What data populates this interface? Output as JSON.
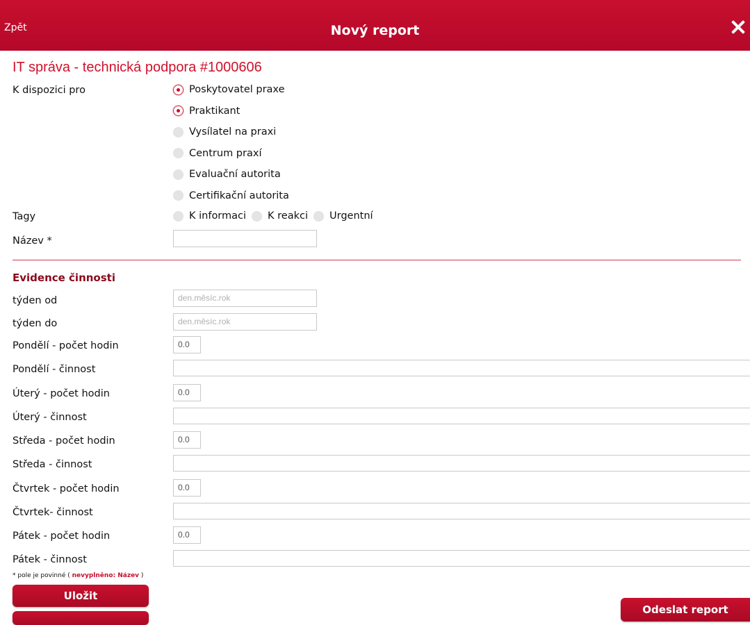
{
  "header": {
    "back_label": "Zpět",
    "title": "Nový report"
  },
  "heading": "IT správa - technická podpora #1000606",
  "availability": {
    "label": "K dispozici pro",
    "options": [
      {
        "label": "Poskytovatel praxe",
        "checked": true
      },
      {
        "label": "Praktikant",
        "checked": true
      },
      {
        "label": "Vysílatel na praxi",
        "checked": false
      },
      {
        "label": "Centrum praxí",
        "checked": false
      },
      {
        "label": "Evaluační autorita",
        "checked": false
      },
      {
        "label": "Certifikační autorita",
        "checked": false
      }
    ]
  },
  "tags": {
    "label": "Tagy",
    "options": [
      {
        "label": "K informaci",
        "checked": false
      },
      {
        "label": "K reakci",
        "checked": false
      },
      {
        "label": "Urgentní",
        "checked": false
      }
    ]
  },
  "name_field": {
    "label": "Název *",
    "value": ""
  },
  "section_title": "Evidence činnosti",
  "week_from": {
    "label": "týden od",
    "placeholder": "den.měsíc.rok"
  },
  "week_to": {
    "label": "týden do",
    "placeholder": "den.měsíc.rok"
  },
  "days": [
    {
      "hours_label": "Pondělí - počet hodin",
      "hours_value": "0.0",
      "activity_label": "Pondělí - činnost",
      "activity_value": ""
    },
    {
      "hours_label": "Úterý - počet hodin",
      "hours_value": "0.0",
      "activity_label": "Úterý - činnost",
      "activity_value": ""
    },
    {
      "hours_label": "Středa - počet hodin",
      "hours_value": "0.0",
      "activity_label": "Středa - činnost",
      "activity_value": ""
    },
    {
      "hours_label": "Čtvrtek - počet hodin",
      "hours_value": "0.0",
      "activity_label": "Čtvrtek- činnost",
      "activity_value": ""
    },
    {
      "hours_label": "Pátek - počet hodin",
      "hours_value": "0.0",
      "activity_label": "Pátek - činnost",
      "activity_value": ""
    }
  ],
  "footer": {
    "note_prefix": "* pole je povinné (",
    "note_missing": "nevyplněno: Název",
    "note_suffix": ")",
    "save_label": "Uložit",
    "send_label": "Odeslat report"
  },
  "colors": {
    "accent": "#c8102e",
    "section": "#8a0a1c"
  }
}
